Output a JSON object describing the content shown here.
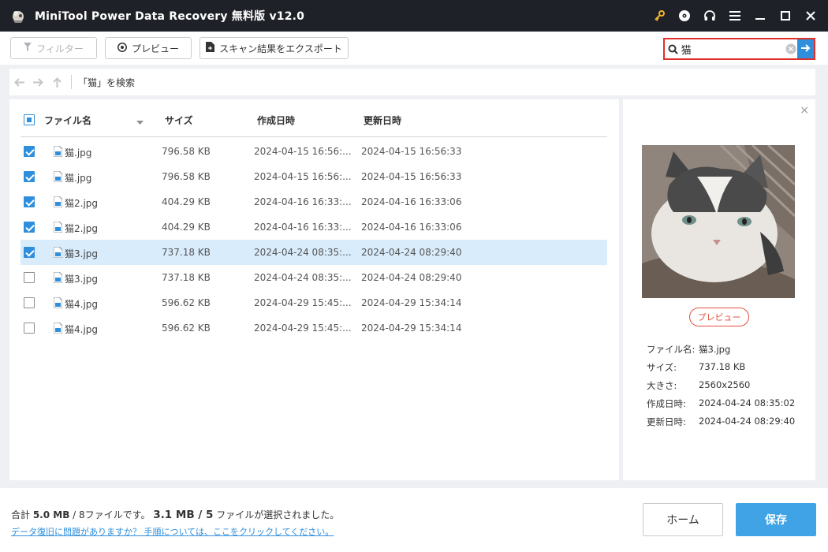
{
  "app": {
    "title": "MiniTool Power Data Recovery 無料版 v12.0"
  },
  "toolbar": {
    "filter_label": "フィルター",
    "preview_label": "プレビュー",
    "export_label": "スキャン結果をエクスポート"
  },
  "search": {
    "value": "猫",
    "placeholder": ""
  },
  "nav": {
    "path": "「猫」を検索"
  },
  "list": {
    "columns": {
      "name": "ファイル名",
      "size": "サイズ",
      "created": "作成日時",
      "modified": "更新日時"
    },
    "rows": [
      {
        "name": "猫.jpg",
        "size": "796.58 KB",
        "created": "2024-04-15 16:56:...",
        "modified": "2024-04-15 16:56:33",
        "checked": true
      },
      {
        "name": "猫.jpg",
        "size": "796.58 KB",
        "created": "2024-04-15 16:56:...",
        "modified": "2024-04-15 16:56:33",
        "checked": true
      },
      {
        "name": "猫2.jpg",
        "size": "404.29 KB",
        "created": "2024-04-16 16:33:...",
        "modified": "2024-04-16 16:33:06",
        "checked": true
      },
      {
        "name": "猫2.jpg",
        "size": "404.29 KB",
        "created": "2024-04-16 16:33:...",
        "modified": "2024-04-16 16:33:06",
        "checked": true
      },
      {
        "name": "猫3.jpg",
        "size": "737.18 KB",
        "created": "2024-04-24 08:35:...",
        "modified": "2024-04-24 08:29:40",
        "checked": true,
        "selected": true
      },
      {
        "name": "猫3.jpg",
        "size": "737.18 KB",
        "created": "2024-04-24 08:35:...",
        "modified": "2024-04-24 08:29:40",
        "checked": false
      },
      {
        "name": "猫4.jpg",
        "size": "596.62 KB",
        "created": "2024-04-29 15:45:...",
        "modified": "2024-04-29 15:34:14",
        "checked": false
      },
      {
        "name": "猫4.jpg",
        "size": "596.62 KB",
        "created": "2024-04-29 15:45:...",
        "modified": "2024-04-29 15:34:14",
        "checked": false
      }
    ]
  },
  "preview": {
    "button_label": "プレビュー",
    "info": [
      {
        "label": "ファイル名:",
        "value": "猫3.jpg"
      },
      {
        "label": "サイズ:",
        "value": "737.18 KB"
      },
      {
        "label": "大きさ:",
        "value": "2560x2560"
      },
      {
        "label": "作成日時:",
        "value": "2024-04-24 08:35:02"
      },
      {
        "label": "更新日時:",
        "value": "2024-04-24 08:29:40"
      }
    ]
  },
  "footer": {
    "summary_prefix": "合計 ",
    "summary_total_size": "5.0 MB",
    "summary_total_mid": " / 8ファイルです。 ",
    "summary_sel_size": "3.1 MB",
    "summary_sel_sep": " / ",
    "summary_sel_count": "5",
    "summary_suffix": " ファイルが選択されました。",
    "help_link": "データ復旧に問題がありますか？ 手順については、ここをクリックしてください。",
    "home_label": "ホーム",
    "save_label": "保存"
  },
  "colors": {
    "accent": "#3fa3e6",
    "titlebar": "#1f2129",
    "highlight": "#e0302a",
    "selected_row": "#d9ecfb"
  },
  "icons": [
    "app-logo-icon",
    "key-icon",
    "disc-icon",
    "headset-icon",
    "menu-icon",
    "minimize-icon",
    "maximize-icon",
    "close-icon",
    "filter-icon",
    "eye-icon",
    "export-icon",
    "search-icon",
    "clear-icon",
    "arrow-right-icon",
    "back-icon",
    "forward-icon",
    "up-icon",
    "sort-icon",
    "file-icon"
  ]
}
